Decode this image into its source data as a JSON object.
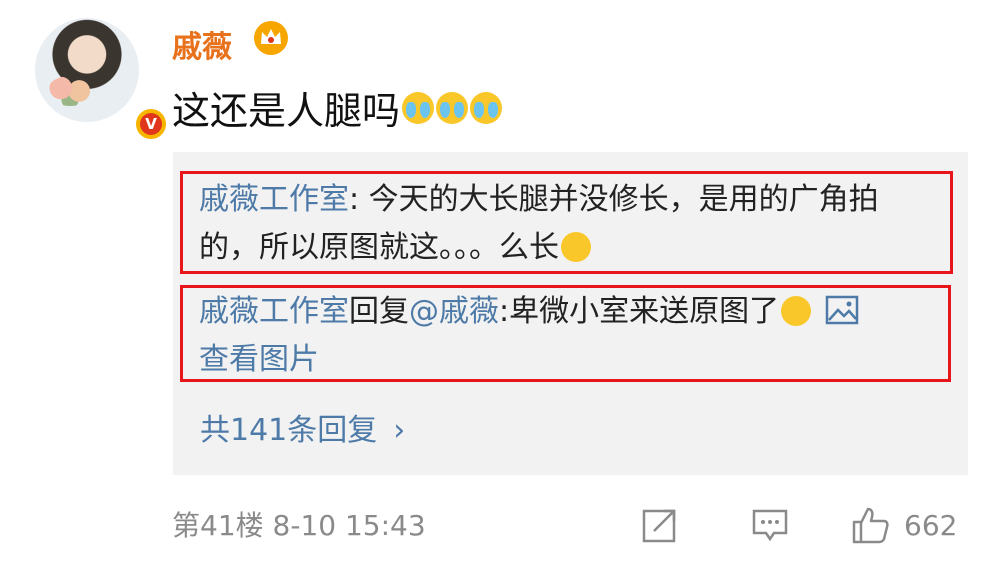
{
  "post": {
    "username": "戚薇",
    "text": "这还是人腿吗",
    "emoji_count": 3,
    "emoji_icon": "crying-laughing-emoji",
    "colors": {
      "username": "#e8711b",
      "link": "#4e7aa8",
      "highlight_border": "#e8161a"
    }
  },
  "replies": [
    {
      "author": "戚薇工作室",
      "separator": ": ",
      "text": "今天的大长腿并没修长，是用的广角拍的，所以原图就这。。。么长",
      "emoji_icon": "covering-mouth-emoji"
    },
    {
      "author": "戚薇工作室",
      "reply_word": "回复",
      "mention": "@戚薇",
      "separator": ":",
      "text": "卑微小室来送原图了",
      "emoji_icon": "shy-face-emoji",
      "view_image_label": "查看图片"
    }
  ],
  "more_replies_label": "共141条回复",
  "footer": {
    "floor_time": "第41楼 8-10 15:43",
    "like_count": "662"
  }
}
